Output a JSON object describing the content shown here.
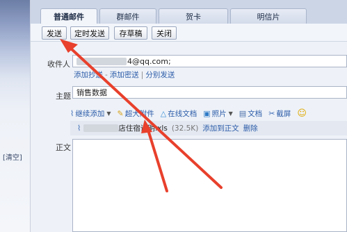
{
  "sidebar": {
    "clear_label": "[清空]"
  },
  "tabs": [
    {
      "label": "普通邮件",
      "active": true
    },
    {
      "label": "群邮件",
      "active": false
    },
    {
      "label": "贺卡",
      "active": false
    },
    {
      "label": "明信片",
      "active": false
    }
  ],
  "toolbar": {
    "send": "发送",
    "scheduled_send": "定时发送",
    "save_draft": "存草稿",
    "close": "关闭"
  },
  "compose": {
    "recipient_label": "收件人",
    "recipient_value": "4@qq.com;",
    "add_cc": "添加抄送",
    "add_bcc": "添加密送",
    "separate_send": "分别发送",
    "subject_label": "主题",
    "subject_value": "销售数据",
    "body_label": "正文"
  },
  "attach_toolbar": {
    "continue_add": "继续添加",
    "large_attachment": "超大附件",
    "online_doc": "在线文档",
    "photo": "照片",
    "document": "文档",
    "screenshot": "截屏"
  },
  "attachment": {
    "file_name": "店住宿证明.xls",
    "file_size": "(32.5K)",
    "add_to_body": "添加到正文",
    "delete": "删除"
  },
  "colors": {
    "annotation_arrow": "#e8402c",
    "link": "#2b5ba8"
  }
}
